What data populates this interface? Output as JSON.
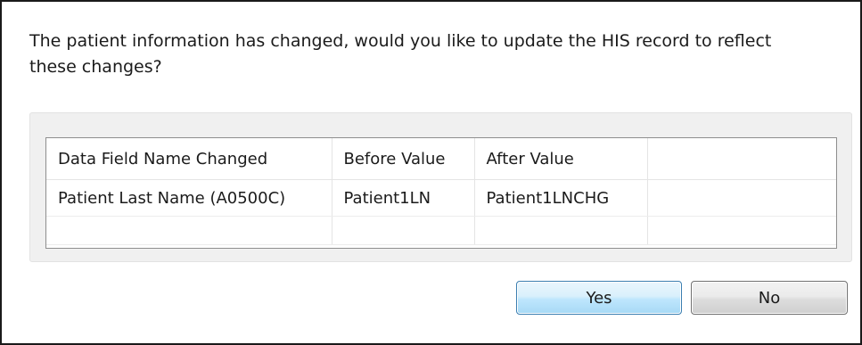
{
  "dialog": {
    "message": "The patient information has changed, would you like to update the HIS record to reflect these changes?"
  },
  "table": {
    "columns": [
      "Data Field Name Changed",
      "Before Value",
      "After Value",
      ""
    ],
    "rows": [
      [
        "Patient Last Name (A0500C)",
        "Patient1LN",
        "Patient1LNCHG",
        ""
      ],
      [
        "",
        "",
        "",
        ""
      ]
    ]
  },
  "buttons": {
    "yes_label": "Yes",
    "no_label": "No"
  },
  "colors": {
    "default_button_border": "#3c7fb1",
    "default_button_fill": "#bee6fd",
    "panel_background": "#f0f0f0"
  }
}
